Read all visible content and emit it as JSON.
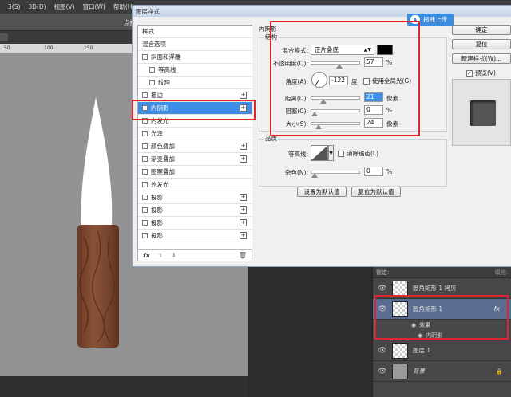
{
  "menubar": {
    "items": [
      "3(S)",
      "3D(D)",
      "视图(V)",
      "窗口(W)",
      "帮助(H)"
    ]
  },
  "options_bar": {
    "hint": "点按并拖"
  },
  "ruler": {
    "marks": [
      "50",
      "100",
      "150"
    ]
  },
  "dialog": {
    "title": "图层样式",
    "upload_label": "拖拽上传",
    "styles": {
      "header": "样式",
      "blend_options": "混合选项",
      "items": [
        {
          "label": "斜面和浮雕",
          "checked": false,
          "sub": false,
          "plus": false
        },
        {
          "label": "等高线",
          "checked": false,
          "sub": true,
          "plus": false
        },
        {
          "label": "纹理",
          "checked": false,
          "sub": true,
          "plus": false
        },
        {
          "label": "描边",
          "checked": false,
          "sub": false,
          "plus": true
        },
        {
          "label": "内阴影",
          "checked": true,
          "sub": false,
          "plus": true,
          "selected": true
        },
        {
          "label": "内发光",
          "checked": false,
          "sub": false,
          "plus": false
        },
        {
          "label": "光泽",
          "checked": false,
          "sub": false,
          "plus": false
        },
        {
          "label": "颜色叠加",
          "checked": false,
          "sub": false,
          "plus": true
        },
        {
          "label": "渐变叠加",
          "checked": false,
          "sub": false,
          "plus": true
        },
        {
          "label": "图案叠加",
          "checked": false,
          "sub": false,
          "plus": false
        },
        {
          "label": "外发光",
          "checked": false,
          "sub": false,
          "plus": false
        },
        {
          "label": "投影",
          "checked": false,
          "sub": false,
          "plus": true
        },
        {
          "label": "投影",
          "checked": false,
          "sub": false,
          "plus": true
        },
        {
          "label": "投影",
          "checked": false,
          "sub": false,
          "plus": true
        },
        {
          "label": "投影",
          "checked": false,
          "sub": false,
          "plus": true
        }
      ],
      "footer": {
        "fx": "fx",
        "up": "⬆",
        "down": "⬇",
        "trash": "🗑"
      }
    },
    "inner_shadow": {
      "title": "内阴影",
      "structure_title": "结构",
      "blend_mode_label": "混合模式:",
      "blend_mode_value": "正片叠底",
      "blend_color": "#000000",
      "opacity_label": "不透明度(O):",
      "opacity_value": "57",
      "opacity_pct": 0.57,
      "angle_label": "角度(A):",
      "angle_value": "-122",
      "angle_unit": "度",
      "global_light_label": "使用全局光(G)",
      "distance_label": "距离(D):",
      "distance_value": "21",
      "distance_frac": 0.21,
      "choke_label": "阻塞(C):",
      "choke_value": "0",
      "choke_frac": 0,
      "size_label": "大小(S):",
      "size_value": "24",
      "size_frac": 0.097,
      "px_unit": "像素",
      "pct_unit": "%"
    },
    "quality": {
      "title": "品质",
      "contour_label": "等高线:",
      "antialias_label": "消除锯齿(L)",
      "noise_label": "杂色(N):",
      "noise_value": "0",
      "noise_frac": 0
    },
    "set_default": "设置为默认值",
    "reset_default": "复位为默认值",
    "buttons": {
      "ok": "确定",
      "reset": "复位",
      "new_style": "新建样式(W)...",
      "preview": "预览(V)"
    }
  },
  "layers": {
    "lock_label": "锁定:",
    "fill_label": "填充:",
    "rows": [
      {
        "name": "圆角矩形 1 拷贝",
        "kind": "layer"
      },
      {
        "name": "圆角矩形 1",
        "kind": "layer",
        "selected": true,
        "fx": "fx"
      },
      {
        "name": "效果",
        "kind": "effect"
      },
      {
        "name": "内阴影",
        "kind": "effect-sub"
      },
      {
        "name": "图层 1",
        "kind": "layer"
      },
      {
        "name": "背景",
        "kind": "bg"
      }
    ]
  },
  "colors": {
    "highlight": "#e0262f",
    "selection": "#3c8ee6",
    "wood": "#7a4630"
  }
}
